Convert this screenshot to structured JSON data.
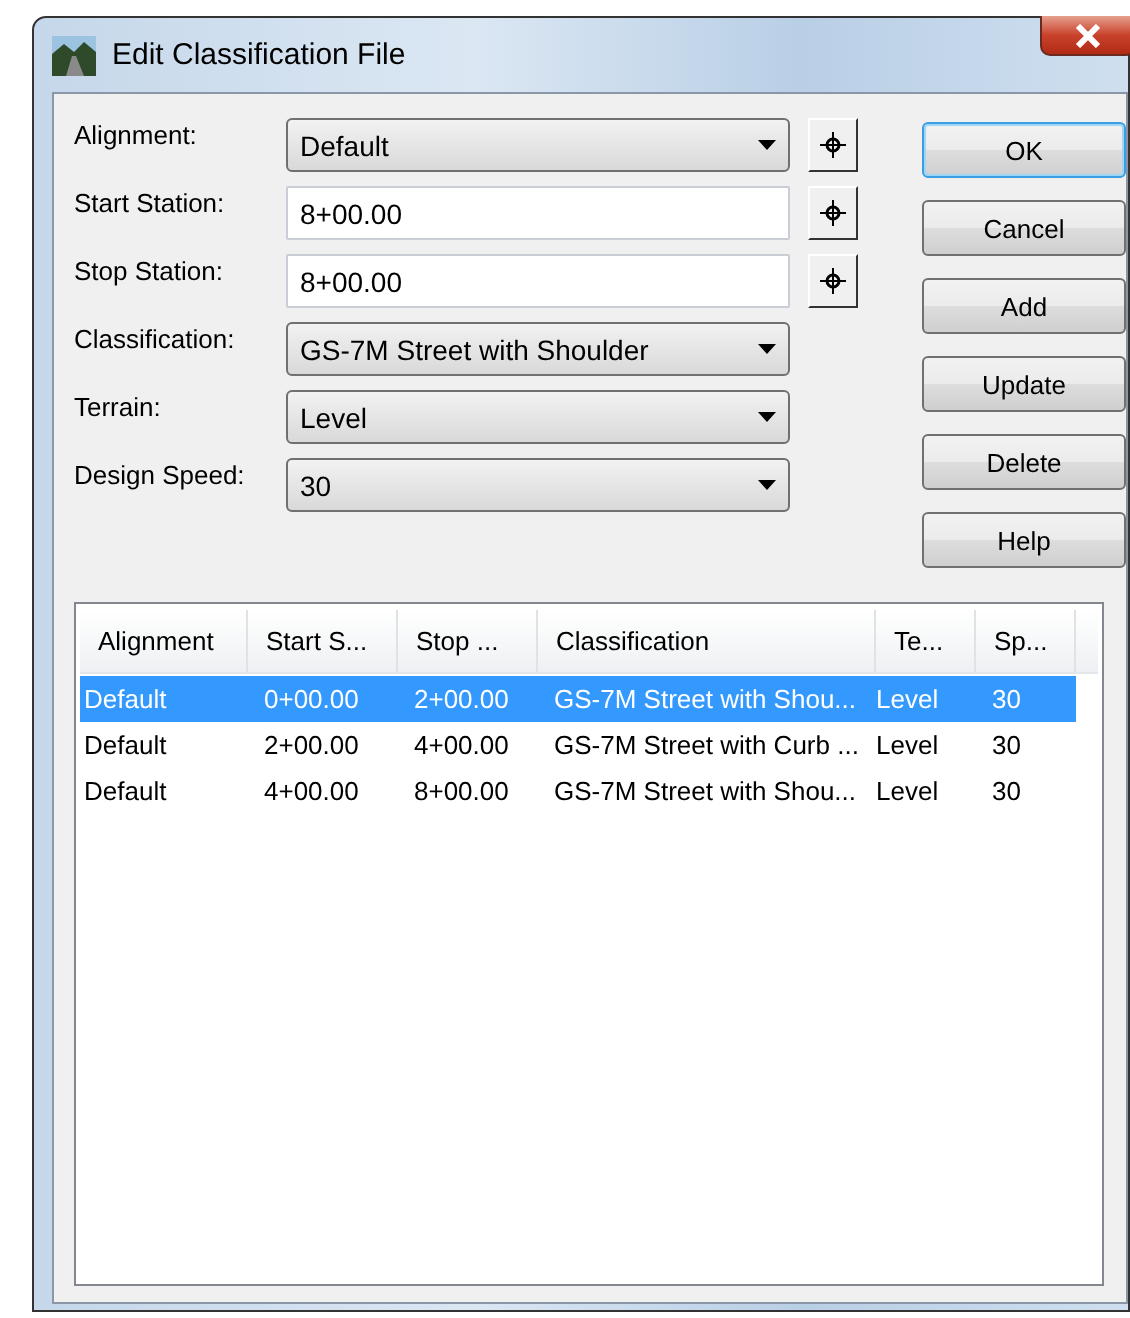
{
  "window": {
    "title": "Edit Classification File"
  },
  "form": [
    {
      "kind": "combo",
      "label": "Alignment:",
      "value": "Default",
      "pick": true
    },
    {
      "kind": "text",
      "label": "Start Station:",
      "value": "8+00.00",
      "pick": true
    },
    {
      "kind": "text",
      "label": "Stop Station:",
      "value": "8+00.00",
      "pick": true
    },
    {
      "kind": "combo",
      "label": "Classification:",
      "value": "GS-7M Street with Shoulder",
      "pick": false
    },
    {
      "kind": "combo",
      "label": "Terrain:",
      "value": "Level",
      "pick": false
    },
    {
      "kind": "combo",
      "label": "Design Speed:",
      "value": "30",
      "pick": false
    }
  ],
  "buttons": [
    {
      "label": "OK",
      "default": true
    },
    {
      "label": "Cancel",
      "default": false
    },
    {
      "label": "Add",
      "default": false
    },
    {
      "label": "Update",
      "default": false
    },
    {
      "label": "Delete",
      "default": false
    },
    {
      "label": "Help",
      "default": false
    }
  ],
  "list": {
    "columns": [
      "Alignment",
      "Start S...",
      "Stop ...",
      "Classification",
      "Te...",
      "Sp..."
    ],
    "rows": [
      {
        "cells": [
          "Default",
          "0+00.00",
          "2+00.00",
          "GS-7M Street with Shou...",
          "Level",
          "30"
        ],
        "selected": true
      },
      {
        "cells": [
          "Default",
          "2+00.00",
          "4+00.00",
          "GS-7M Street with Curb ...",
          "Level",
          "30"
        ],
        "selected": false
      },
      {
        "cells": [
          "Default",
          "4+00.00",
          "8+00.00",
          "GS-7M Street with Shou...",
          "Level",
          "30"
        ],
        "selected": false
      }
    ]
  }
}
